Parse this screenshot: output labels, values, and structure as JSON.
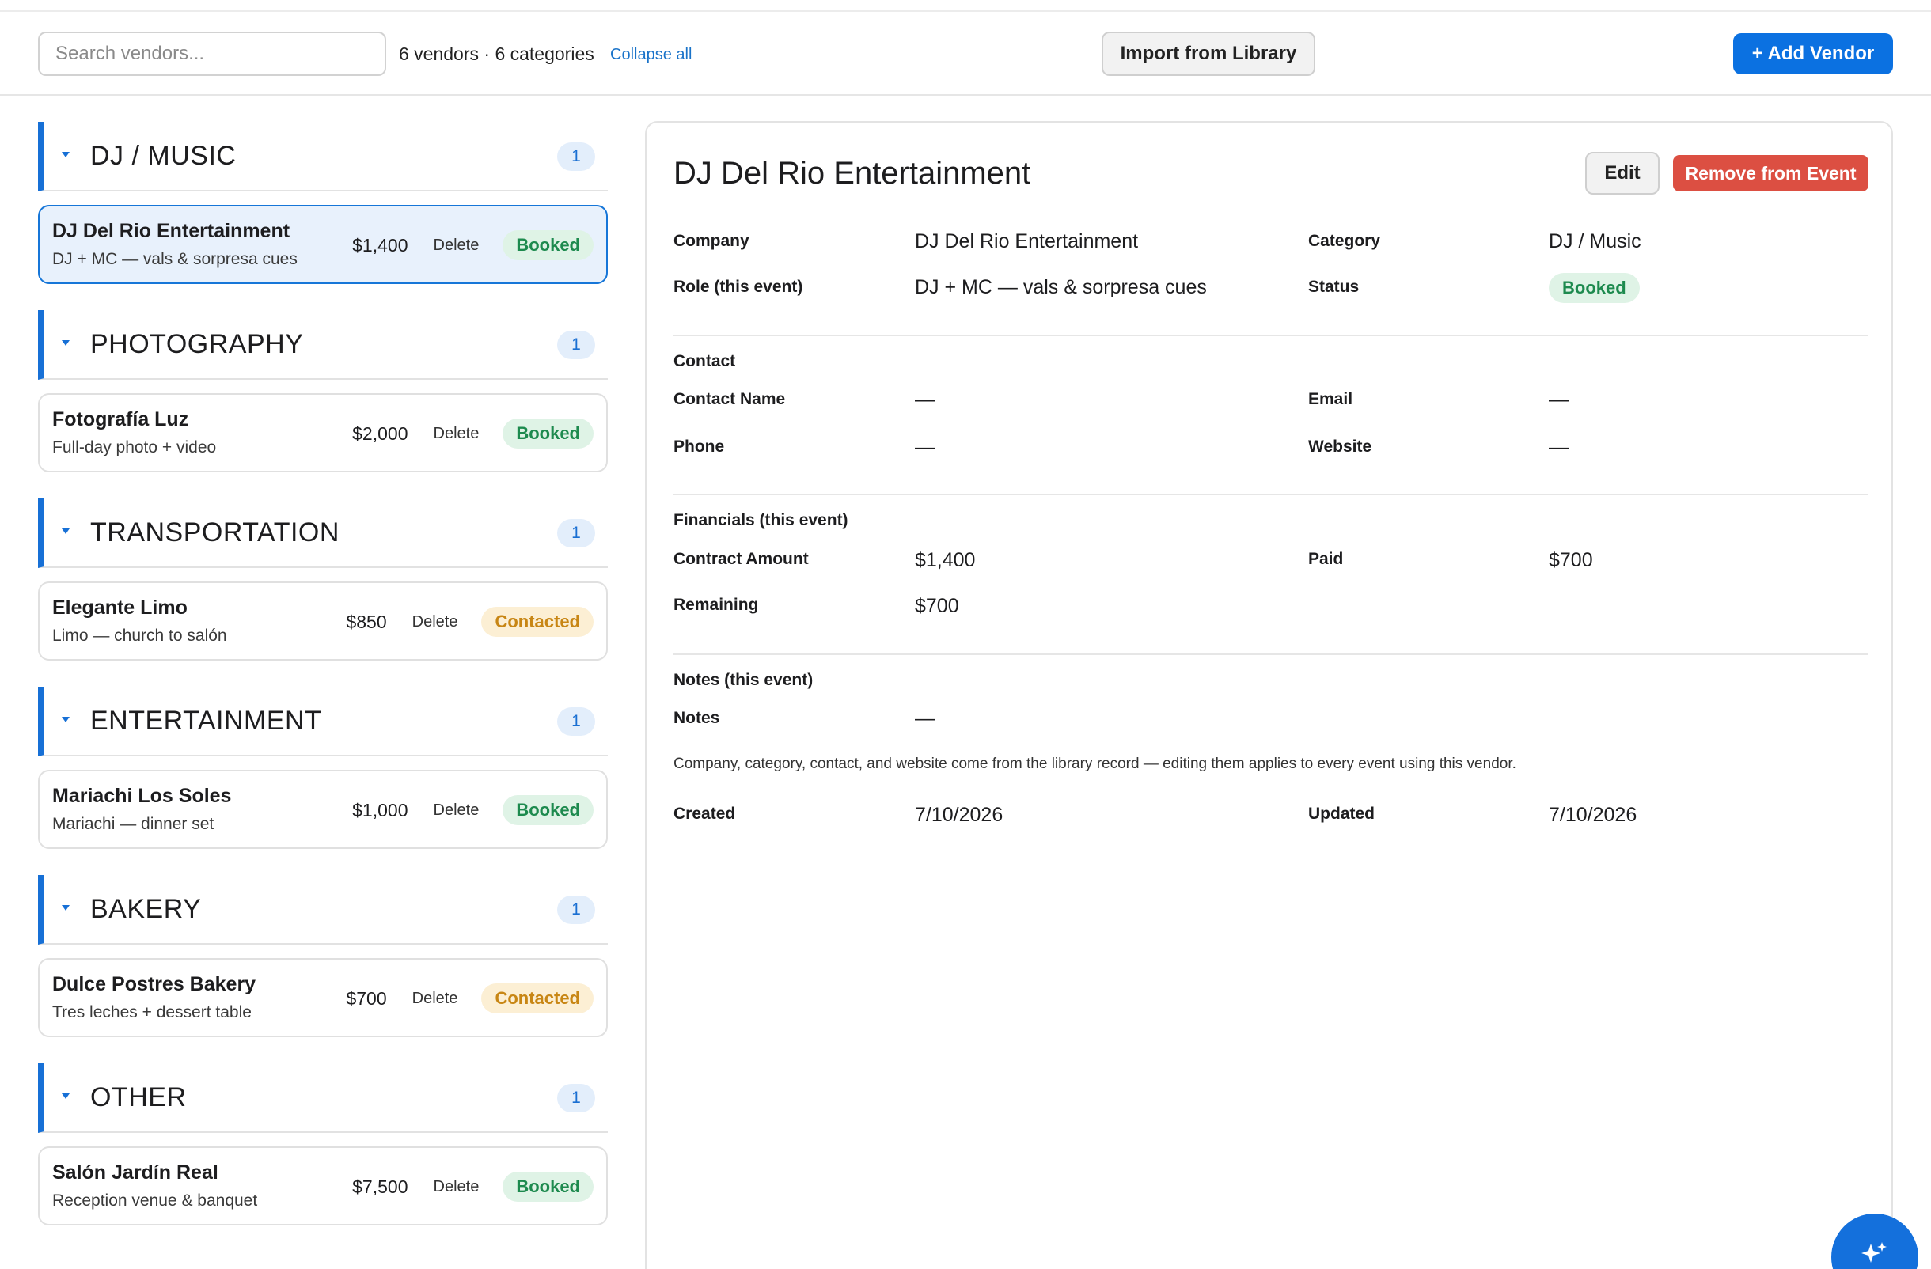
{
  "toolbar": {
    "search_placeholder": "Search vendors...",
    "summary": "6 vendors · 6 categories",
    "collapse_label": "Collapse all",
    "import_label": "Import from Library",
    "add_label": "+ Add Vendor"
  },
  "categories": [
    {
      "title": "DJ / MUSIC",
      "count": "1",
      "vendor": {
        "name": "DJ Del Rio Entertainment",
        "role": "DJ + MC — vals & sorpresa cues",
        "amount": "$1,400",
        "delete": "Delete",
        "status": "Booked"
      }
    },
    {
      "title": "PHOTOGRAPHY",
      "count": "1",
      "vendor": {
        "name": "Fotografía Luz",
        "role": "Full-day photo + video",
        "amount": "$2,000",
        "delete": "Delete",
        "status": "Booked"
      }
    },
    {
      "title": "TRANSPORTATION",
      "count": "1",
      "vendor": {
        "name": "Elegante Limo",
        "role": "Limo — church to salón",
        "amount": "$850",
        "delete": "Delete",
        "status": "Contacted"
      }
    },
    {
      "title": "ENTERTAINMENT",
      "count": "1",
      "vendor": {
        "name": "Mariachi Los Soles",
        "role": "Mariachi — dinner set",
        "amount": "$1,000",
        "delete": "Delete",
        "status": "Booked"
      }
    },
    {
      "title": "BAKERY",
      "count": "1",
      "vendor": {
        "name": "Dulce Postres Bakery",
        "role": "Tres leches + dessert table",
        "amount": "$700",
        "delete": "Delete",
        "status": "Contacted"
      }
    },
    {
      "title": "OTHER",
      "count": "1",
      "vendor": {
        "name": "Salón Jardín Real",
        "role": "Reception venue & banquet",
        "amount": "$7,500",
        "delete": "Delete",
        "status": "Booked"
      }
    }
  ],
  "detail": {
    "title": "DJ Del Rio Entertainment",
    "edit_label": "Edit",
    "remove_label": "Remove from Event",
    "company_label": "Company",
    "company": "DJ Del Rio Entertainment",
    "category_label": "Category",
    "category": "DJ / Music",
    "role_label": "Role (this event)",
    "role": "DJ + MC — vals & sorpresa cues",
    "status_label": "Status",
    "status": "Booked",
    "contact_section": "Contact",
    "contact_name_label": "Contact Name",
    "contact_name": "—",
    "email_label": "Email",
    "email": "—",
    "phone_label": "Phone",
    "phone": "—",
    "website_label": "Website",
    "website": "—",
    "financials_section": "Financials (this event)",
    "contract_label": "Contract Amount",
    "contract": "$1,400",
    "paid_label": "Paid",
    "paid": "$700",
    "remaining_label": "Remaining",
    "remaining": "$700",
    "notes_section": "Notes (this event)",
    "notes_label": "Notes",
    "notes": "—",
    "footnote": "Company, category, contact, and website come from the library record — editing them applies to every event using this vendor.",
    "created_label": "Created",
    "created": "7/10/2026",
    "updated_label": "Updated",
    "updated": "7/10/2026"
  },
  "colors": {
    "accent": "#0b71e1",
    "danger": "#dc4f42",
    "booked": "#1d8a4e",
    "contacted": "#c88614"
  },
  "fab": {
    "icon": "sparkle-icon"
  }
}
